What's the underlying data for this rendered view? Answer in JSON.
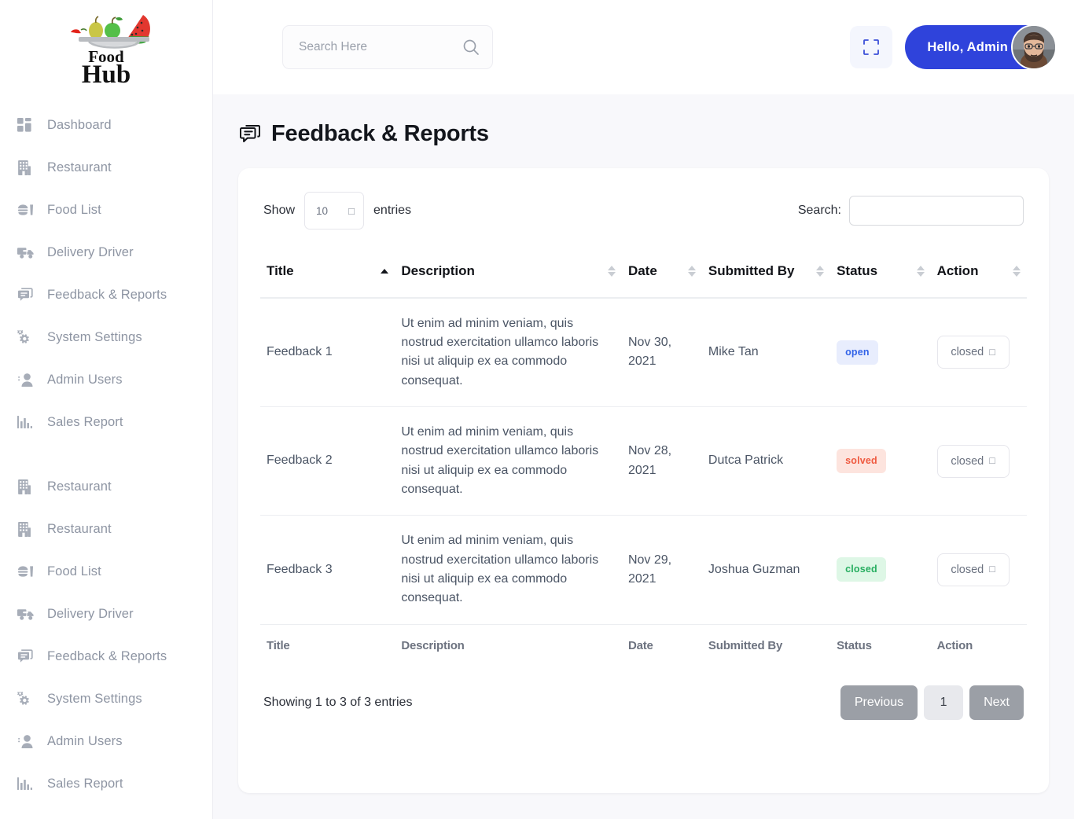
{
  "brand": {
    "name_top": "Food",
    "name_bottom": "Hub",
    "logo_alt": "food-hub-logo"
  },
  "sidebar": {
    "group1": [
      {
        "label": "Dashboard",
        "icon": "dashboard-icon"
      },
      {
        "label": "Restaurant",
        "icon": "building-icon"
      },
      {
        "label": "Food List",
        "icon": "food-icon"
      },
      {
        "label": "Delivery Driver",
        "icon": "truck-icon"
      },
      {
        "label": "Feedback & Reports",
        "icon": "comments-icon"
      },
      {
        "label": "System Settings",
        "icon": "cogs-icon"
      },
      {
        "label": "Admin Users",
        "icon": "user-shield-icon"
      },
      {
        "label": "Sales Report",
        "icon": "chart-bar-icon"
      }
    ],
    "group2": [
      {
        "label": "Restaurant",
        "icon": "building-icon"
      },
      {
        "label": "Restaurant",
        "icon": "building-icon"
      },
      {
        "label": "Food List",
        "icon": "food-icon"
      },
      {
        "label": "Delivery Driver",
        "icon": "truck-icon"
      },
      {
        "label": "Feedback & Reports",
        "icon": "comments-icon"
      },
      {
        "label": "System Settings",
        "icon": "cogs-icon"
      },
      {
        "label": "Admin Users",
        "icon": "user-shield-icon"
      },
      {
        "label": "Sales Report",
        "icon": "chart-bar-icon"
      }
    ]
  },
  "topbar": {
    "search_placeholder": "Search Here",
    "search_value": "",
    "search_icon": "search-icon",
    "fullscreen_icon": "fullscreen-icon",
    "greeting": "Hello, Admin",
    "avatar_alt": "user-avatar"
  },
  "page": {
    "title": "Feedback & Reports",
    "title_icon": "comments-icon"
  },
  "table_controls": {
    "show_label": "Show",
    "entries_label": "entries",
    "page_length": "10",
    "page_length_glyph": "□",
    "search_label": "Search:",
    "search_value": "",
    "search_placeholder": ""
  },
  "table": {
    "columns": [
      {
        "label": "Title",
        "sort": "asc"
      },
      {
        "label": "Description",
        "sort": "none"
      },
      {
        "label": "Date",
        "sort": "none"
      },
      {
        "label": "Submitted By",
        "sort": "none"
      },
      {
        "label": "Status",
        "sort": "none"
      },
      {
        "label": "Action",
        "sort": "none"
      }
    ],
    "footer_columns": [
      "Title",
      "Description",
      "Date",
      "Submitted By",
      "Status",
      "Action"
    ],
    "rows": [
      {
        "title": "Feedback 1",
        "description": "Ut enim ad minim veniam, quis nostrud exercitation ullamco laboris nisi ut aliquip ex ea commodo consequat.",
        "date": "Nov 30, 2021",
        "submitted_by": "Mike Tan",
        "status": "open",
        "status_style": "open",
        "action_value": "closed",
        "action_glyph": "□"
      },
      {
        "title": "Feedback 2",
        "description": "Ut enim ad minim veniam, quis nostrud exercitation ullamco laboris nisi ut aliquip ex ea commodo consequat.",
        "date": "Nov 28, 2021",
        "submitted_by": "Dutca Patrick",
        "status": "solved",
        "status_style": "solved",
        "action_value": "closed",
        "action_glyph": "□"
      },
      {
        "title": "Feedback 3",
        "description": "Ut enim ad minim veniam, quis nostrud exercitation ullamco laboris nisi ut aliquip ex ea commodo consequat.",
        "date": "Nov 29, 2021",
        "submitted_by": "Joshua Guzman",
        "status": "closed",
        "status_style": "closed",
        "action_value": "closed",
        "action_glyph": "□"
      }
    ]
  },
  "pagination": {
    "info": "Showing 1 to 3 of 3 entries",
    "previous": "Previous",
    "pages": [
      "1"
    ],
    "next": "Next",
    "current_page": "1"
  },
  "colors": {
    "accent_blue": "#2f43db",
    "badge_open": "#3263e8",
    "badge_solved": "#ef5a40",
    "badge_closed": "#27ae60",
    "sidebar_text": "#8e95a3",
    "page_bg": "#f8f8fb"
  }
}
